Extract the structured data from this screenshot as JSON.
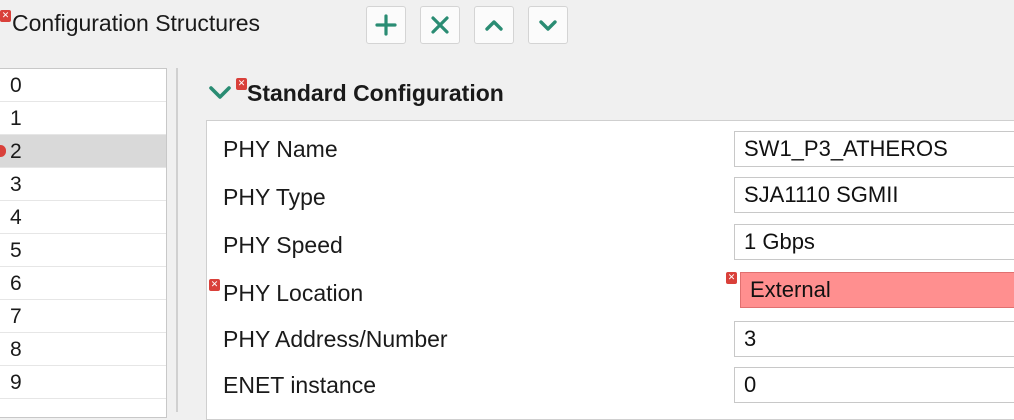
{
  "header": {
    "title": "Configuration Structures",
    "toolbar": {
      "add_icon": "plus-icon",
      "remove_icon": "x-icon",
      "move_up_icon": "chevron-up-icon",
      "move_down_icon": "chevron-down-icon"
    }
  },
  "list": {
    "items": [
      "0",
      "1",
      "2",
      "3",
      "4",
      "5",
      "6",
      "7",
      "8",
      "9"
    ],
    "selected": "2"
  },
  "section": {
    "title": "Standard Configuration",
    "expanded": true
  },
  "fields": [
    {
      "label": "PHY Name",
      "value": "SW1_P3_ATHEROS",
      "error": false
    },
    {
      "label": "PHY Type",
      "value": "SJA1110 SGMII",
      "error": false
    },
    {
      "label": "PHY Speed",
      "value": "1 Gbps",
      "error": false
    },
    {
      "label": "PHY Location",
      "value": "External",
      "error": true
    },
    {
      "label": "PHY Address/Number",
      "value": "3",
      "error": false
    },
    {
      "label": "ENET instance",
      "value": "0",
      "error": false
    }
  ],
  "colors": {
    "accent": "#2a8c73",
    "error": "#d9403a",
    "error_field_bg": "#ff8f8f",
    "selected_row": "#d9d9d9"
  }
}
